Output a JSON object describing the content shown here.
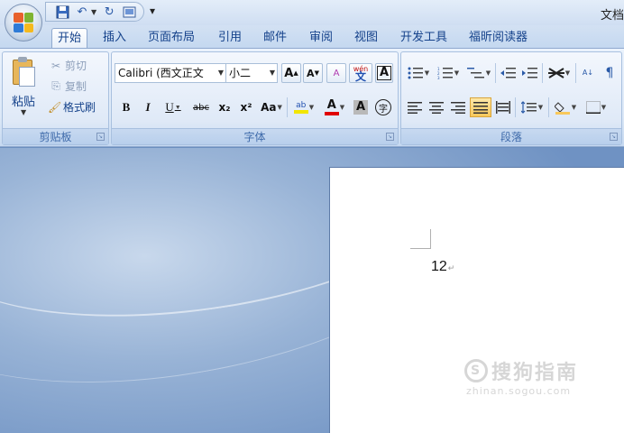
{
  "window": {
    "title": "文档"
  },
  "qat": {
    "more_icon": "▾"
  },
  "tabs": [
    {
      "label": "开始",
      "active": true
    },
    {
      "label": "插入"
    },
    {
      "label": "页面布局"
    },
    {
      "label": "引用"
    },
    {
      "label": "邮件"
    },
    {
      "label": "审阅"
    },
    {
      "label": "视图"
    },
    {
      "label": "开发工具"
    },
    {
      "label": "福昕阅读器"
    }
  ],
  "clipboard": {
    "paste_label": "粘贴",
    "cut_label": "剪切",
    "copy_label": "复制",
    "format_painter_label": "格式刷",
    "group_label": "剪贴板"
  },
  "font": {
    "font_name": "Calibri (西文正文",
    "font_size": "小二",
    "grow_label": "A",
    "shrink_label": "A",
    "clear_label": "A",
    "phonetic_label": "wén",
    "border_label": "A",
    "bold_label": "B",
    "italic_label": "I",
    "underline_label": "U",
    "strike_label": "abc",
    "subscript_label": "x₂",
    "superscript_label": "x²",
    "case_label": "Aa",
    "highlight_label": "ab",
    "color_label": "A",
    "shade_label": "A",
    "enclose_label": "字",
    "group_label": "字体",
    "highlight_color": "#f2e600",
    "font_color": "#e00000"
  },
  "paragraph": {
    "group_label": "段落",
    "sort_label": "A↓",
    "accent_color": "#f8c85b"
  },
  "document": {
    "text": "12",
    "para_mark": "↵"
  },
  "watermark": {
    "main": "搜狗指南",
    "sub": "zhinan.sogou.com"
  }
}
